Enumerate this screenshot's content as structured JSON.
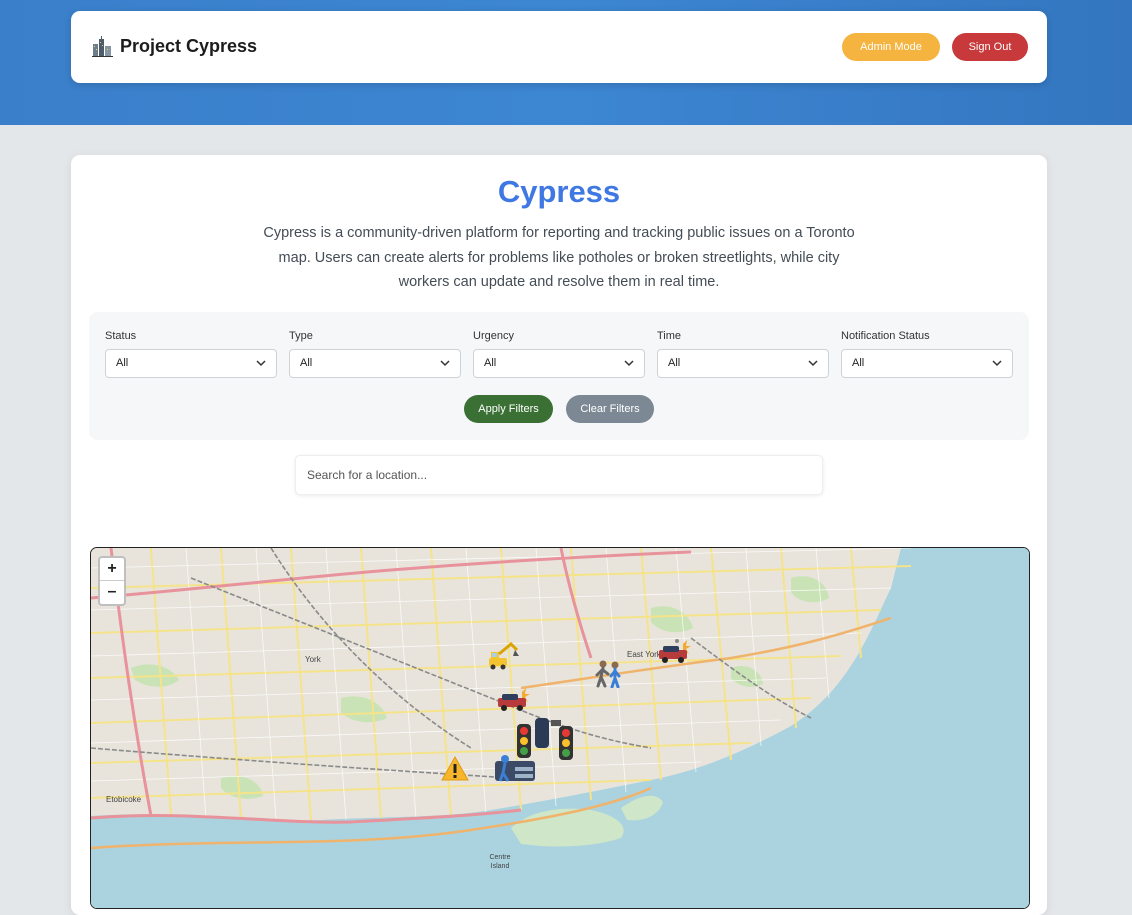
{
  "app": {
    "name": "Project Cypress",
    "admin_label": "Admin Mode",
    "signout_label": "Sign Out"
  },
  "hero": {
    "title": "Cypress",
    "description": "Cypress is a community-driven platform for reporting and tracking public issues on a Toronto map. Users can create alerts for problems like potholes or broken streetlights, while city workers can update and resolve them in real time."
  },
  "filters": {
    "fields": [
      {
        "label": "Status",
        "value": "All"
      },
      {
        "label": "Type",
        "value": "All"
      },
      {
        "label": "Urgency",
        "value": "All"
      },
      {
        "label": "Time",
        "value": "All"
      },
      {
        "label": "Notification Status",
        "value": "All"
      }
    ],
    "apply_label": "Apply Filters",
    "clear_label": "Clear Filters"
  },
  "search": {
    "placeholder": "Search for a location..."
  },
  "map": {
    "zoom_in": "+",
    "zoom_out": "–",
    "labels": {
      "york": "York",
      "east_york": "East York",
      "etobicoke": "Etobicoke",
      "centre_island": "Centre Island"
    },
    "markers": [
      "construction-icon",
      "pedestrian-icon",
      "crash-icon",
      "traffic-light-icon",
      "warning-icon"
    ]
  },
  "colors": {
    "primary": "#3f78e3",
    "admin": "#f5b33f",
    "signout": "#c8393b",
    "apply": "#3b7035",
    "clear": "#7c8893",
    "header": "#3a7fca"
  }
}
